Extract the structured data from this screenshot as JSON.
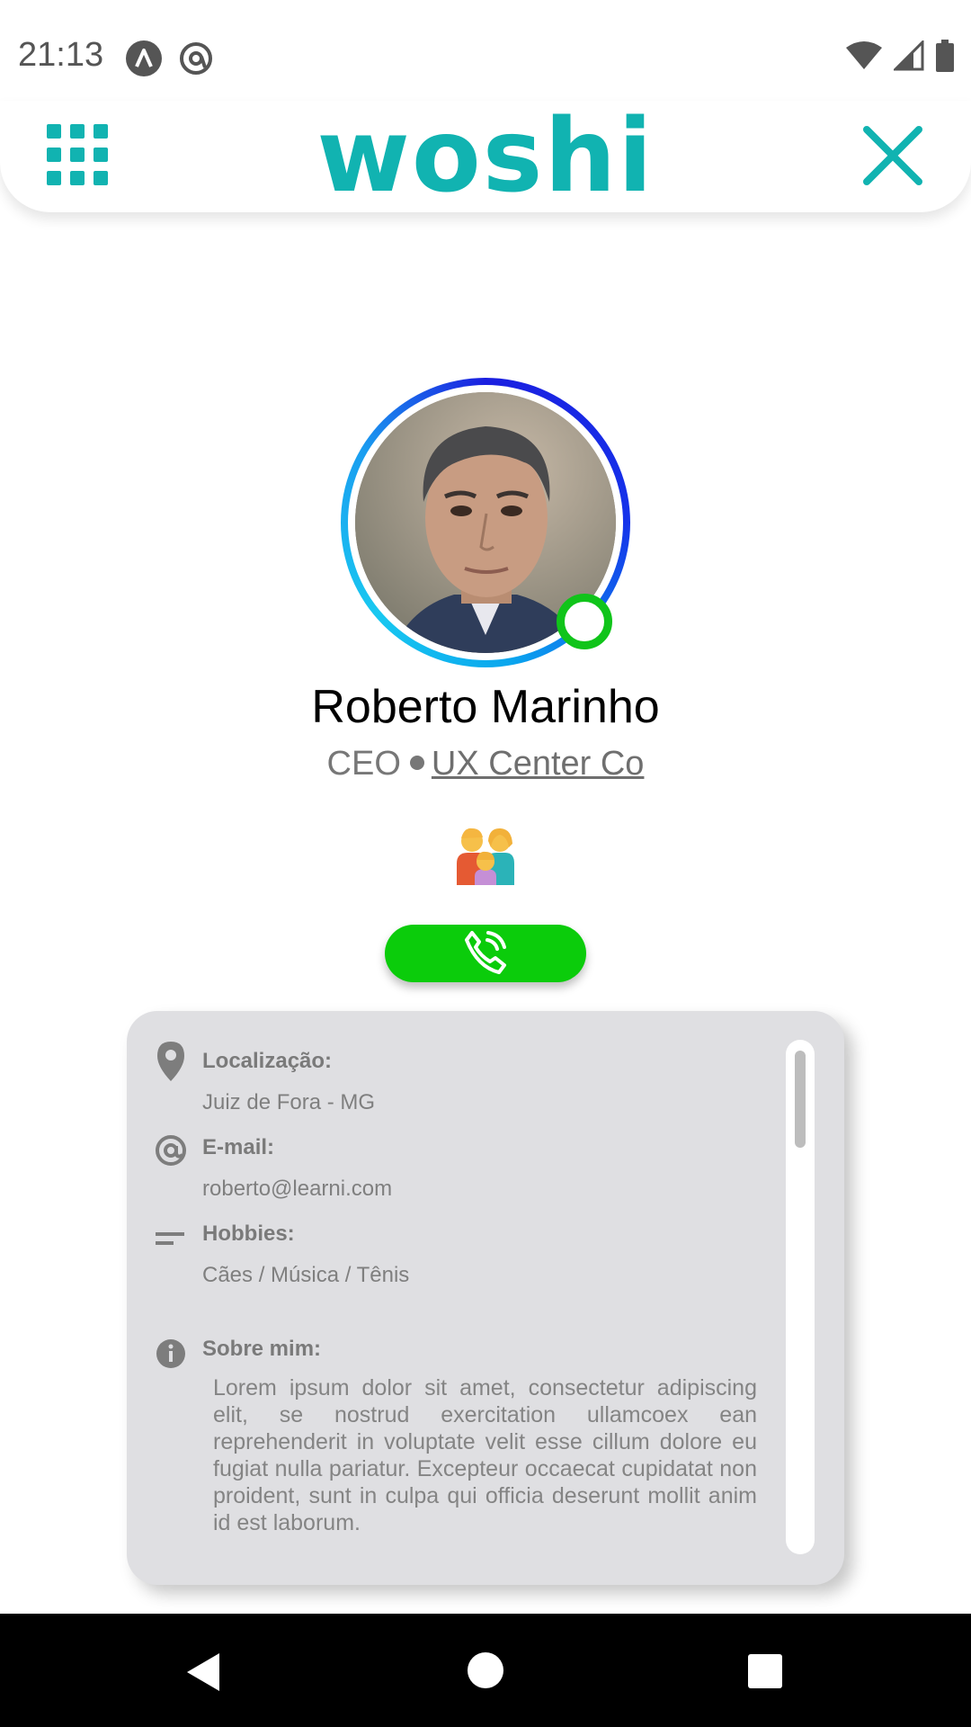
{
  "status_bar": {
    "time": "21:13",
    "left_icons": [
      "android-a-icon",
      "at-sign-icon"
    ],
    "right_icons": [
      "wifi-icon",
      "cell-signal-icon",
      "battery-icon"
    ]
  },
  "header": {
    "logo": "woshi",
    "menu_icon": "grid-menu-icon",
    "close_icon": "close-icon",
    "accent_color": "#11b3b1"
  },
  "profile": {
    "name": "Roberto Marinho",
    "role": "CEO",
    "company": "UX Center Co",
    "presence_status": "online",
    "presence_color": "#10c41a",
    "relationship_icon": "family-icon",
    "call_button_icon": "phone-call-icon",
    "call_button_color": "#0bcc0b"
  },
  "info": {
    "location_label": "Localização:",
    "location_value": "Juiz de Fora - MG",
    "email_label": "E-mail:",
    "email_value": "roberto@learni.com",
    "hobbies_label": "Hobbies:",
    "hobbies_value": "Cães / Música / Tênis",
    "about_label": "Sobre mim:",
    "about_value": "Lorem ipsum dolor sit amet, consectetur adipiscing elit, se nostrud exercitation ullamcoex ean reprehenderit in voluptate velit esse cillum dolore eu fugiat nulla pariatur. Excepteur occaecat cupidatat non proident, sunt in culpa qui officia deserunt mollit anim id est laborum."
  },
  "nav_bar": {
    "back_icon": "back-triangle-icon",
    "home_icon": "home-circle-icon",
    "recents_icon": "recents-square-icon"
  }
}
